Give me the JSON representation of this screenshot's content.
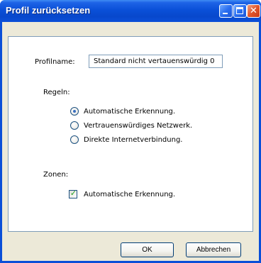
{
  "window": {
    "title": "Profil zurücksetzen",
    "close_glyph": "✕",
    "icons": {
      "minimize": "minimize-icon",
      "maximize": "maximize-icon",
      "close": "close-icon"
    }
  },
  "form": {
    "profile_label": "Profilname:",
    "profile_value": "Standard nicht vertauenswürdig 0",
    "rules_label": "Regeln:",
    "rules_options": [
      {
        "label": "Automatische Erkennung.",
        "selected": true
      },
      {
        "label": "Vertrauenswürdiges Netzwerk.",
        "selected": false
      },
      {
        "label": "Direkte Internetverbindung.",
        "selected": false
      }
    ],
    "zones_label": "Zonen:",
    "zones_option": {
      "label": "Automatische Erkennung.",
      "checked": true
    }
  },
  "buttons": {
    "ok": "OK",
    "cancel": "Abbrechen"
  },
  "colors": {
    "titlebar": "#0a50d8",
    "client": "#ece9d8",
    "radio_selected": "#3a6fbf",
    "check": "#21a121"
  }
}
